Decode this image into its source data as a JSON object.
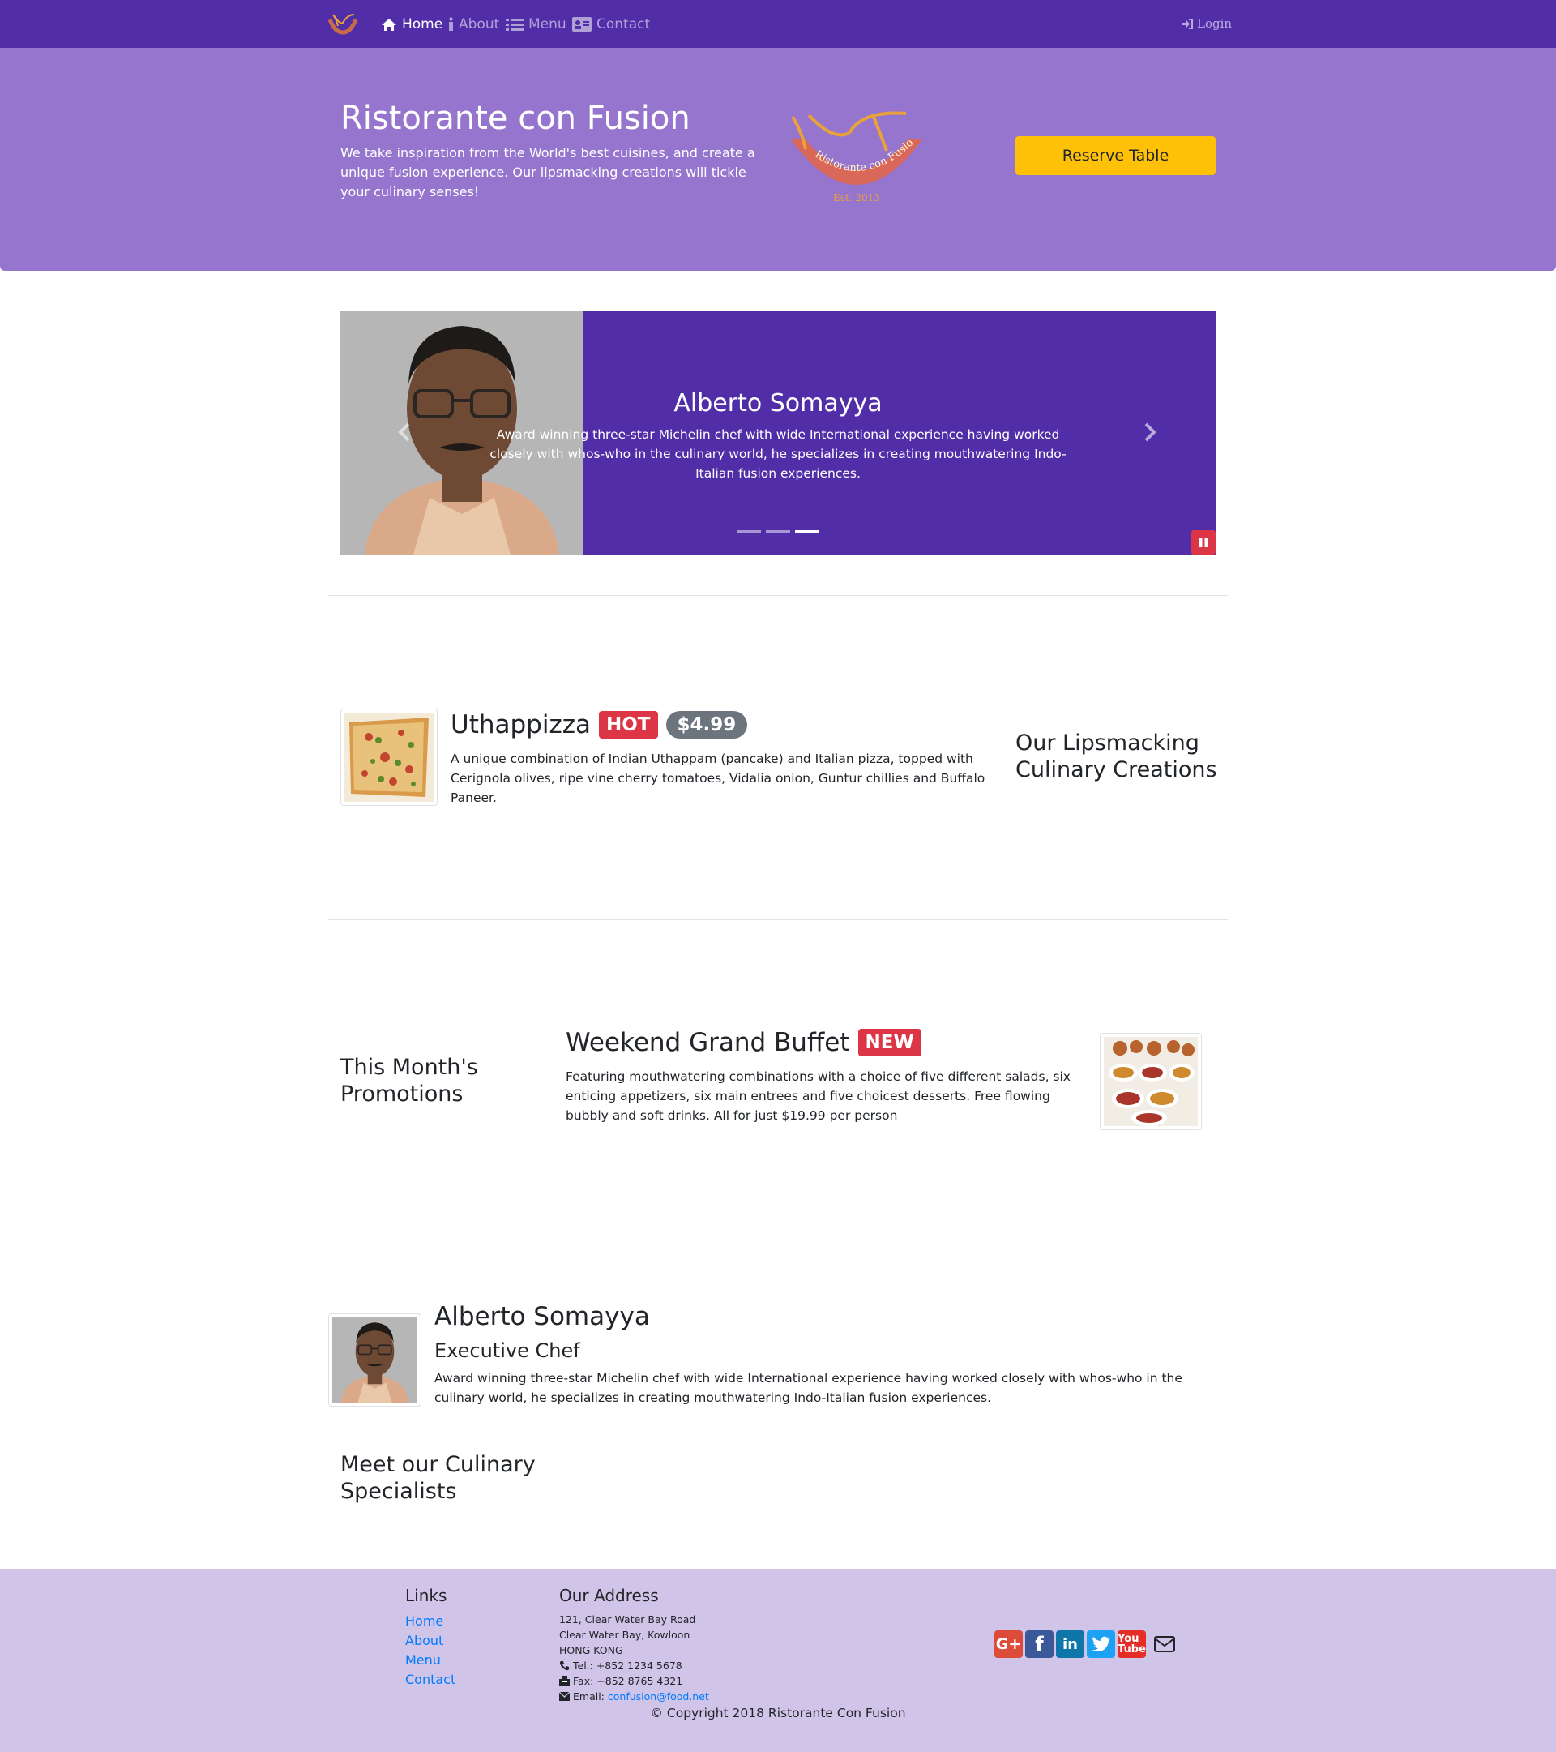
{
  "nav": {
    "home": "Home",
    "about": "About",
    "menu": "Menu",
    "contact": "Contact",
    "login": "Login"
  },
  "jumbotron": {
    "title": "Ristorante con Fusion",
    "text": "We take inspiration from the World's best cuisines, and create a unique fusion experience. Our lipsmacking creations will tickle your culinary senses!",
    "reserve_label": "Reserve Table",
    "logo_text": "Ristorante con Fusion",
    "logo_est": "Est. 2013"
  },
  "carousel": {
    "title": "Alberto Somayya",
    "text": "Award winning three-star Michelin chef with wide International experience having worked closely with whos-who in the culinary world, he specializes in creating mouthwatering Indo-Italian fusion experiences.",
    "slides_total": 3,
    "active_slide": 3
  },
  "dish": {
    "name": "Uthappizza",
    "badge": "HOT",
    "price": "$4.99",
    "description": "A unique combination of Indian Uthappam (pancake) and Italian pizza, topped with Cerignola olives, ripe vine cherry tomatoes, Vidalia onion, Guntur chillies and Buffalo Paneer.",
    "section_title": "Our Lipsmacking Culinary Creations"
  },
  "promotion": {
    "section_title": "This Month's Promotions",
    "name": "Weekend Grand Buffet",
    "badge": "NEW",
    "description": "Featuring mouthwatering combinations with a choice of five different salads, six enticing appetizers, six main entrees and five choicest desserts. Free flowing bubbly and soft drinks. All for just $19.99 per person"
  },
  "leader": {
    "name": "Alberto Somayya",
    "designation": "Executive Chef",
    "description": "Award winning three-star Michelin chef with wide International experience having worked closely with whos-who in the culinary world, he specializes in creating mouthwatering Indo-Italian fusion experiences.",
    "section_title": "Meet our Culinary Specialists"
  },
  "footer": {
    "links_title": "Links",
    "links": [
      "Home",
      "About",
      "Menu",
      "Contact"
    ],
    "address_title": "Our Address",
    "address_lines": [
      "121, Clear Water Bay Road",
      "Clear Water Bay, Kowloon",
      "HONG KONG"
    ],
    "tel": "Tel.: +852 1234 5678",
    "fax": "Fax: +852 8765 4321",
    "email_label": "Email: ",
    "email": "confusion@food.net",
    "social": [
      "google-plus-icon",
      "facebook-icon",
      "linkedin-icon",
      "twitter-icon",
      "youtube-icon",
      "mail-icon"
    ],
    "copyright": "© Copyright 2018 Ristorante Con Fusion"
  },
  "colors": {
    "primary": "#512da8",
    "jumbotron": "#9575cd",
    "footer": "#d1c4e9",
    "warning": "#ffc107",
    "danger": "#dc3545",
    "secondary": "#6c757d",
    "link": "#007bff"
  }
}
